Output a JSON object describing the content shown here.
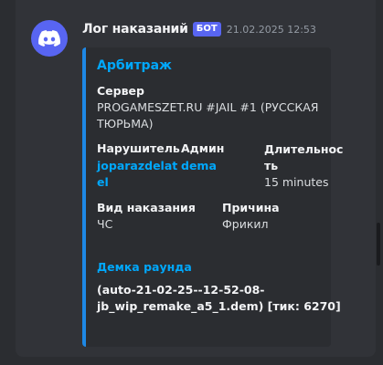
{
  "message": {
    "author": "Лог наказаний",
    "badge": "БОТ",
    "timestamp": "21.02.2025 12:53"
  },
  "embed": {
    "accent_color": "#1e88e5",
    "title": "Арбитраж",
    "server": {
      "label": "Сервер",
      "value_line1": "PROGAMESZET.RU #JAIL #1 (РУССКАЯ",
      "value_line2": "ТЮРЬМА)"
    },
    "offender": {
      "label": "Нарушитель",
      "value_line1": "joparazdelat",
      "value_line2": "el"
    },
    "admin": {
      "label": "Админ",
      "value": "dema"
    },
    "duration": {
      "label_line1": "Длительнос",
      "label_line2": "ть",
      "value": "15 minutes"
    },
    "punishment_type": {
      "label": "Вид наказания",
      "value": "ЧС"
    },
    "reason": {
      "label": "Причина",
      "value": "Фрикил"
    },
    "demo": {
      "label": "Демка раунда",
      "value_line1": "(auto-21-02-25--12-52-08-",
      "value_line2": "jb_wip_remake_a5_1.dem) [тик: 6270]"
    }
  },
  "icons": {
    "avatar": "discord-logo-icon"
  },
  "colors": {
    "background": "#2b2d31",
    "message_bg": "#313338",
    "avatar_bg": "#5865f2",
    "link": "#00a8fc"
  }
}
